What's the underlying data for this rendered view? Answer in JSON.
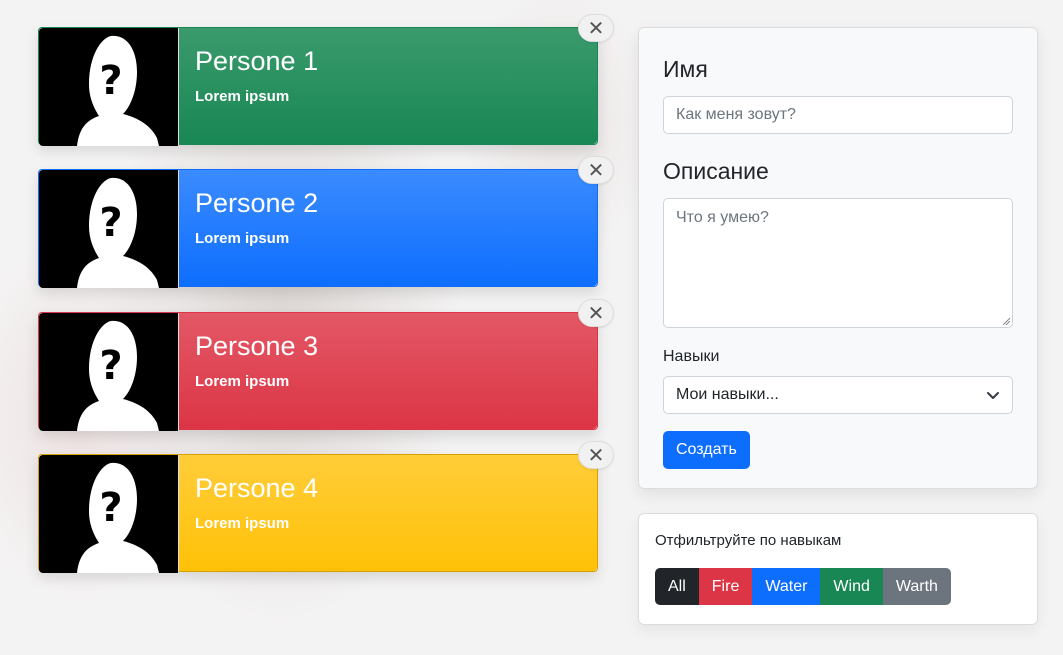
{
  "cards": [
    {
      "title": "Persone 1",
      "text": "Lorem ipsum",
      "color": "#198754"
    },
    {
      "title": "Persone 2",
      "text": "Lorem ipsum",
      "color": "#0d6efd"
    },
    {
      "title": "Persone 3",
      "text": "Lorem ipsum",
      "color": "#dc3545"
    },
    {
      "title": "Persone 4",
      "text": "Lorem ipsum",
      "color": "#ffc107"
    }
  ],
  "close_icon": "close-icon",
  "avatar_icon": "unknown-person-icon",
  "form": {
    "name_heading": "Имя",
    "name_placeholder": "Как меня зовут?",
    "description_heading": "Описание",
    "description_placeholder": "Что я умею?",
    "skills_label": "Навыки",
    "skills_selected": "Мои навыки...",
    "submit_label": "Создать"
  },
  "filter": {
    "title": "Отфильтруйте по навыкам",
    "buttons": [
      {
        "label": "All",
        "color": "#212529"
      },
      {
        "label": "Fire",
        "color": "#dc3545"
      },
      {
        "label": "Water",
        "color": "#0d6efd"
      },
      {
        "label": "Wind",
        "color": "#198754"
      },
      {
        "label": "Warth",
        "color": "#6c757d"
      }
    ]
  }
}
